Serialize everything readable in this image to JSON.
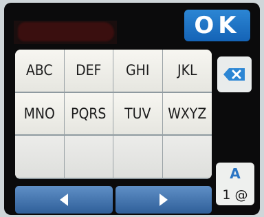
{
  "header": {
    "ok_label": "OK"
  },
  "keypad": {
    "keys": [
      "ABC",
      "DEF",
      "GHI",
      "JKL",
      "MNO",
      "PQRS",
      "TUV",
      "WXYZ",
      "",
      "",
      "",
      ""
    ]
  },
  "side": {
    "mode_top": "A",
    "mode_bottom": "1 @"
  },
  "icons": {
    "delete": "backspace-x-icon",
    "left": "left-arrow-icon",
    "right": "right-arrow-icon"
  }
}
